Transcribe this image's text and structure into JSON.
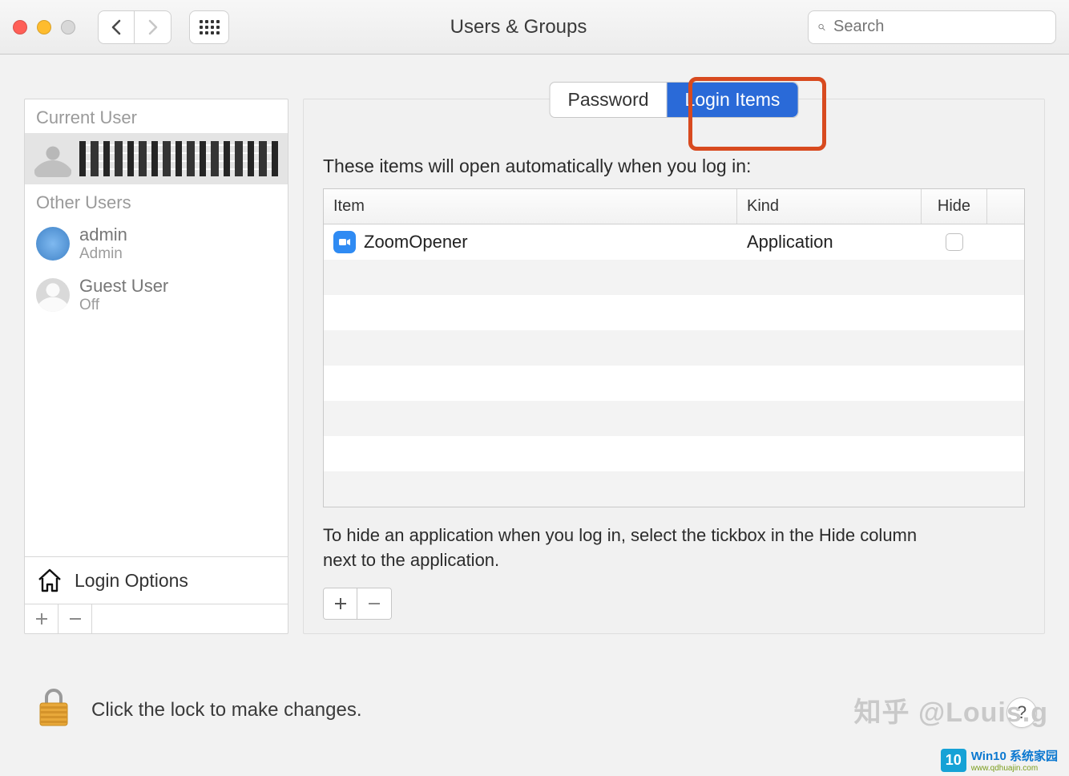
{
  "window": {
    "title": "Users & Groups"
  },
  "search": {
    "placeholder": "Search"
  },
  "sidebar": {
    "current_user_label": "Current User",
    "other_users_label": "Other Users",
    "users": [
      {
        "name": "admin",
        "role": "Admin"
      },
      {
        "name": "Guest User",
        "role": "Off"
      }
    ],
    "login_options_label": "Login Options"
  },
  "tabs": {
    "password": "Password",
    "login_items": "Login Items"
  },
  "main": {
    "intro": "These items will open automatically when you log in:",
    "columns": {
      "item": "Item",
      "kind": "Kind",
      "hide": "Hide"
    },
    "rows": [
      {
        "item": "ZoomOpener",
        "kind": "Application",
        "hide": false
      }
    ],
    "hint": "To hide an application when you log in, select the tickbox in the Hide column next to the application."
  },
  "lock": {
    "text": "Click the lock to make changes."
  },
  "watermark": {
    "main": "知乎 @Louis.g",
    "badge": "10",
    "line1": "Win10 系统家园",
    "line2": "www.qdhuajin.com"
  }
}
